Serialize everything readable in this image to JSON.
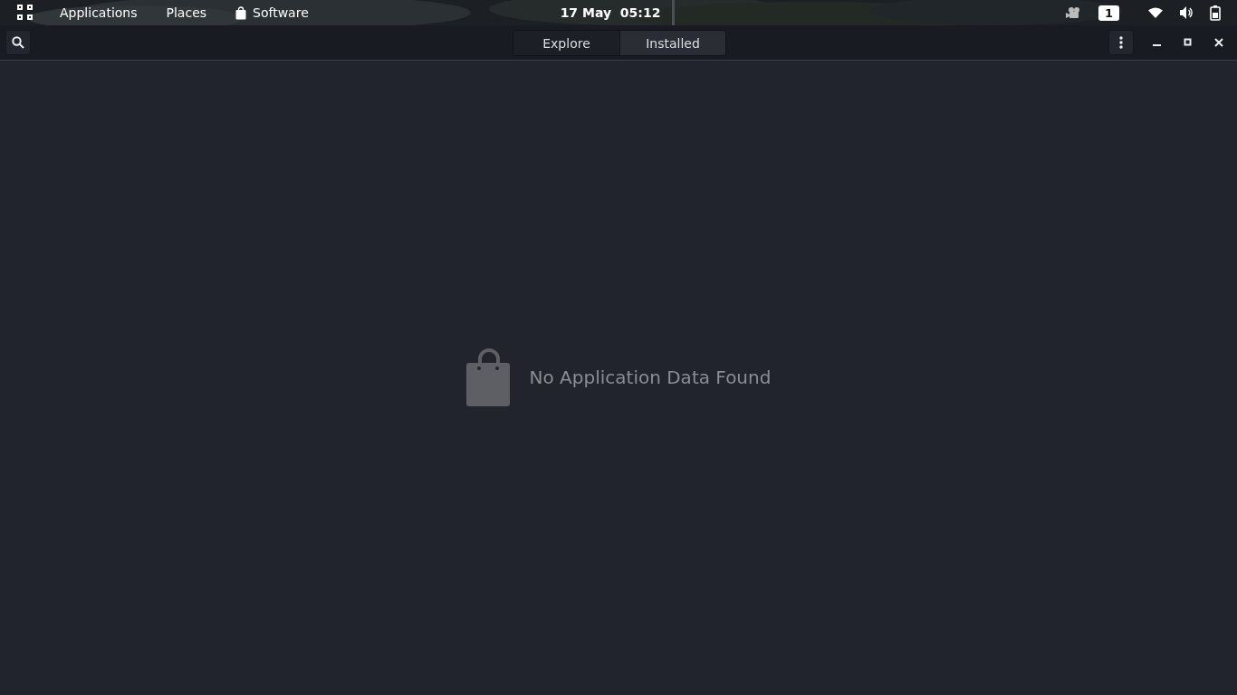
{
  "top_bar": {
    "menus": [
      "Applications",
      "Places"
    ],
    "app_menu": "Software",
    "clock": "17 May  05:12",
    "workspace": "1"
  },
  "header_bar": {
    "tabs": [
      {
        "label": "Explore",
        "selected": true
      },
      {
        "label": "Installed",
        "selected": false
      }
    ]
  },
  "empty_state": {
    "message": "No Application Data Found"
  }
}
